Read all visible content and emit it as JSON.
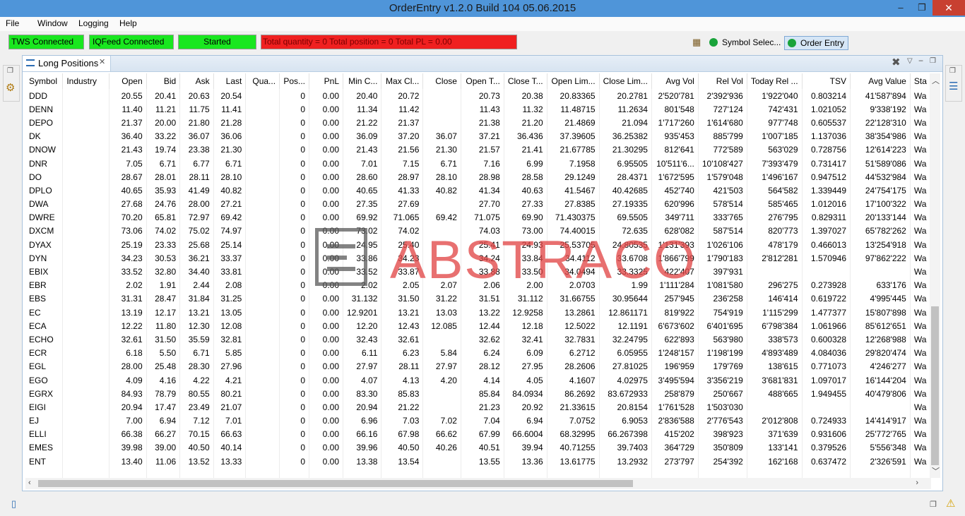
{
  "window": {
    "title": "OrderEntry v1.2.0 Build 104 05.06.2015",
    "minimize": "–",
    "restore": "❐",
    "close": "✕"
  },
  "menu": [
    "File",
    "Window",
    "Logging",
    "Help"
  ],
  "status": {
    "tws": "TWS Connected",
    "iqfeed": "IQFeed Connected",
    "started": "Started",
    "totals": "Total quantity = 0   Total position = 0   Total PL = 0.00",
    "green_color": "#19e71f",
    "red_color": "#f02020"
  },
  "toolbar": {
    "symbol_selector": "Symbol Selec...",
    "order_entry": "Order Entry"
  },
  "view": {
    "tab_label": "Long Positions",
    "tab_close": "✕"
  },
  "table": {
    "columns": [
      "Symbol",
      "Industry",
      "Open",
      "Bid",
      "Ask",
      "Last",
      "Qua...",
      "Pos...",
      "PnL",
      "Min C...",
      "Max Cl...",
      "Close",
      "Open T...",
      "Close T...",
      "Open Lim...",
      "Close Lim...",
      "Avg Vol",
      "Rel Vol",
      "Today Rel ...",
      "TSV",
      "Avg Value",
      "Sta"
    ],
    "rows": [
      [
        "DDD",
        "",
        "20.55",
        "20.41",
        "20.63",
        "20.54",
        "",
        "0",
        "0.00",
        "20.40",
        "20.72",
        "",
        "20.73",
        "20.38",
        "20.83365",
        "20.2781",
        "2'520'781",
        "2'392'936",
        "1'922'040",
        "0.803214",
        "41'587'894",
        "Wa"
      ],
      [
        "DENN",
        "",
        "11.40",
        "11.21",
        "11.75",
        "11.41",
        "",
        "0",
        "0.00",
        "11.34",
        "11.42",
        "",
        "11.43",
        "11.32",
        "11.48715",
        "11.2634",
        "801'548",
        "727'124",
        "742'431",
        "1.021052",
        "9'338'192",
        "Wa"
      ],
      [
        "DEPO",
        "",
        "21.37",
        "20.00",
        "21.80",
        "21.28",
        "",
        "0",
        "0.00",
        "21.22",
        "21.37",
        "",
        "21.38",
        "21.20",
        "21.4869",
        "21.094",
        "1'717'260",
        "1'614'680",
        "977'748",
        "0.605537",
        "22'128'310",
        "Wa"
      ],
      [
        "DK",
        "",
        "36.40",
        "33.22",
        "36.07",
        "36.06",
        "",
        "0",
        "0.00",
        "36.09",
        "37.20",
        "36.07",
        "37.21",
        "36.436",
        "37.39605",
        "36.25382",
        "935'453",
        "885'799",
        "1'007'185",
        "1.137036",
        "38'354'986",
        "Wa"
      ],
      [
        "DNOW",
        "",
        "21.43",
        "19.74",
        "23.38",
        "21.30",
        "",
        "0",
        "0.00",
        "21.43",
        "21.56",
        "21.30",
        "21.57",
        "21.41",
        "21.67785",
        "21.30295",
        "812'641",
        "772'589",
        "563'029",
        "0.728756",
        "12'614'223",
        "Wa"
      ],
      [
        "DNR",
        "",
        "7.05",
        "6.71",
        "6.77",
        "6.71",
        "",
        "0",
        "0.00",
        "7.01",
        "7.15",
        "6.71",
        "7.16",
        "6.99",
        "7.1958",
        "6.95505",
        "10'511'6...",
        "10'108'427",
        "7'393'479",
        "0.731417",
        "51'589'086",
        "Wa"
      ],
      [
        "DO",
        "",
        "28.67",
        "28.01",
        "28.11",
        "28.10",
        "",
        "0",
        "0.00",
        "28.60",
        "28.97",
        "28.10",
        "28.98",
        "28.58",
        "29.1249",
        "28.4371",
        "1'672'595",
        "1'579'048",
        "1'496'167",
        "0.947512",
        "44'532'984",
        "Wa"
      ],
      [
        "DPLO",
        "",
        "40.65",
        "35.93",
        "41.49",
        "40.82",
        "",
        "0",
        "0.00",
        "40.65",
        "41.33",
        "40.82",
        "41.34",
        "40.63",
        "41.5467",
        "40.42685",
        "452'740",
        "421'503",
        "564'582",
        "1.339449",
        "24'754'175",
        "Wa"
      ],
      [
        "DWA",
        "",
        "27.68",
        "24.76",
        "28.00",
        "27.21",
        "",
        "0",
        "0.00",
        "27.35",
        "27.69",
        "",
        "27.70",
        "27.33",
        "27.8385",
        "27.19335",
        "620'996",
        "578'514",
        "585'465",
        "1.012016",
        "17'100'322",
        "Wa"
      ],
      [
        "DWRE",
        "",
        "70.20",
        "65.81",
        "72.97",
        "69.42",
        "",
        "0",
        "0.00",
        "69.92",
        "71.065",
        "69.42",
        "71.075",
        "69.90",
        "71.430375",
        "69.5505",
        "349'711",
        "333'765",
        "276'795",
        "0.829311",
        "20'133'144",
        "Wa"
      ],
      [
        "DXCM",
        "",
        "73.06",
        "74.02",
        "75.02",
        "74.97",
        "",
        "0",
        "0.00",
        "73.02",
        "74.02",
        "",
        "74.03",
        "73.00",
        "74.40015",
        "72.635",
        "628'082",
        "587'514",
        "820'773",
        "1.397027",
        "65'782'262",
        "Wa"
      ],
      [
        "DYAX",
        "",
        "25.19",
        "23.33",
        "25.68",
        "25.14",
        "",
        "0",
        "0.00",
        "24.95",
        "25.40",
        "",
        "25.41",
        "24.93",
        "25.53705",
        "24.80535",
        "1'131'393",
        "1'026'106",
        "478'179",
        "0.466013",
        "13'254'918",
        "Wa"
      ],
      [
        "DYN",
        "",
        "34.23",
        "30.53",
        "36.21",
        "33.37",
        "",
        "0",
        "0.00",
        "33.86",
        "34.23",
        "",
        "34.24",
        "33.84",
        "34.4112",
        "33.6708",
        "1'866'799",
        "1'790'183",
        "2'812'281",
        "1.570946",
        "97'862'222",
        "Wa"
      ],
      [
        "EBIX",
        "",
        "33.52",
        "32.80",
        "34.40",
        "33.81",
        "",
        "0",
        "0.00",
        "33.52",
        "33.87",
        "",
        "33.88",
        "33.50",
        "34.0494",
        "33.3325",
        "422'407",
        "397'931",
        "",
        "",
        "",
        "Wa"
      ],
      [
        "EBR",
        "",
        "2.02",
        "1.91",
        "2.44",
        "2.08",
        "",
        "0",
        "0.00",
        "2.02",
        "2.05",
        "2.07",
        "2.06",
        "2.00",
        "2.0703",
        "1.99",
        "1'111'284",
        "1'081'580",
        "296'275",
        "0.273928",
        "633'176",
        "Wa"
      ],
      [
        "EBS",
        "",
        "31.31",
        "28.47",
        "31.84",
        "31.25",
        "",
        "0",
        "0.00",
        "31.132",
        "31.50",
        "31.22",
        "31.51",
        "31.112",
        "31.66755",
        "30.95644",
        "257'945",
        "236'258",
        "146'414",
        "0.619722",
        "4'995'445",
        "Wa"
      ],
      [
        "EC",
        "",
        "13.19",
        "12.17",
        "13.21",
        "13.05",
        "",
        "0",
        "0.00",
        "12.9201",
        "13.21",
        "13.03",
        "13.22",
        "12.9258",
        "13.2861",
        "12.861171",
        "819'922",
        "754'919",
        "1'115'299",
        "1.477377",
        "15'807'898",
        "Wa"
      ],
      [
        "ECA",
        "",
        "12.22",
        "11.80",
        "12.30",
        "12.08",
        "",
        "0",
        "0.00",
        "12.20",
        "12.43",
        "12.085",
        "12.44",
        "12.18",
        "12.5022",
        "12.1191",
        "6'673'602",
        "6'401'695",
        "6'798'384",
        "1.061966",
        "85'612'651",
        "Wa"
      ],
      [
        "ECHO",
        "",
        "32.61",
        "31.50",
        "35.59",
        "32.81",
        "",
        "0",
        "0.00",
        "32.43",
        "32.61",
        "",
        "32.62",
        "32.41",
        "32.7831",
        "32.24795",
        "622'893",
        "563'980",
        "338'573",
        "0.600328",
        "12'268'988",
        "Wa"
      ],
      [
        "ECR",
        "",
        "6.18",
        "5.50",
        "6.71",
        "5.85",
        "",
        "0",
        "0.00",
        "6.11",
        "6.23",
        "5.84",
        "6.24",
        "6.09",
        "6.2712",
        "6.05955",
        "1'248'157",
        "1'198'199",
        "4'893'489",
        "4.084036",
        "29'820'474",
        "Wa"
      ],
      [
        "EGL",
        "",
        "28.00",
        "25.48",
        "28.30",
        "27.96",
        "",
        "0",
        "0.00",
        "27.97",
        "28.11",
        "27.97",
        "28.12",
        "27.95",
        "28.2606",
        "27.81025",
        "196'959",
        "179'769",
        "138'615",
        "0.771073",
        "4'246'277",
        "Wa"
      ],
      [
        "EGO",
        "",
        "4.09",
        "4.16",
        "4.22",
        "4.21",
        "",
        "0",
        "0.00",
        "4.07",
        "4.13",
        "4.20",
        "4.14",
        "4.05",
        "4.1607",
        "4.02975",
        "3'495'594",
        "3'356'219",
        "3'681'831",
        "1.097017",
        "16'144'204",
        "Wa"
      ],
      [
        "EGRX",
        "",
        "84.93",
        "78.79",
        "80.55",
        "80.21",
        "",
        "0",
        "0.00",
        "83.30",
        "85.83",
        "",
        "85.84",
        "84.0934",
        "86.2692",
        "83.672933",
        "258'879",
        "250'667",
        "488'665",
        "1.949455",
        "40'479'806",
        "Wa"
      ],
      [
        "EIGI",
        "",
        "20.94",
        "17.47",
        "23.49",
        "21.07",
        "",
        "0",
        "0.00",
        "20.94",
        "21.22",
        "",
        "21.23",
        "20.92",
        "21.33615",
        "20.8154",
        "1'761'528",
        "1'503'030",
        "",
        "",
        "",
        "Wa"
      ],
      [
        "EJ",
        "",
        "7.00",
        "6.94",
        "7.12",
        "7.01",
        "",
        "0",
        "0.00",
        "6.96",
        "7.03",
        "7.02",
        "7.04",
        "6.94",
        "7.0752",
        "6.9053",
        "2'836'588",
        "2'776'543",
        "2'012'808",
        "0.724933",
        "14'414'917",
        "Wa"
      ],
      [
        "ELLI",
        "",
        "66.38",
        "66.27",
        "70.15",
        "66.63",
        "",
        "0",
        "0.00",
        "66.16",
        "67.98",
        "66.62",
        "67.99",
        "66.6004",
        "68.32995",
        "66.267398",
        "415'202",
        "398'923",
        "371'639",
        "0.931606",
        "25'772'765",
        "Wa"
      ],
      [
        "EMES",
        "",
        "39.98",
        "39.00",
        "40.50",
        "40.14",
        "",
        "0",
        "0.00",
        "39.96",
        "40.50",
        "40.26",
        "40.51",
        "39.94",
        "40.71255",
        "39.7403",
        "364'729",
        "350'809",
        "133'141",
        "0.379526",
        "5'556'348",
        "Wa"
      ],
      [
        "ENT",
        "",
        "13.40",
        "11.06",
        "13.52",
        "13.33",
        "",
        "0",
        "0.00",
        "13.38",
        "13.54",
        "",
        "13.55",
        "13.36",
        "13.61775",
        "13.2932",
        "273'797",
        "254'392",
        "162'168",
        "0.637472",
        "2'326'591",
        "Wa"
      ]
    ]
  },
  "watermark": {
    "text": "ABSTRACO",
    "color": "#e24848"
  }
}
